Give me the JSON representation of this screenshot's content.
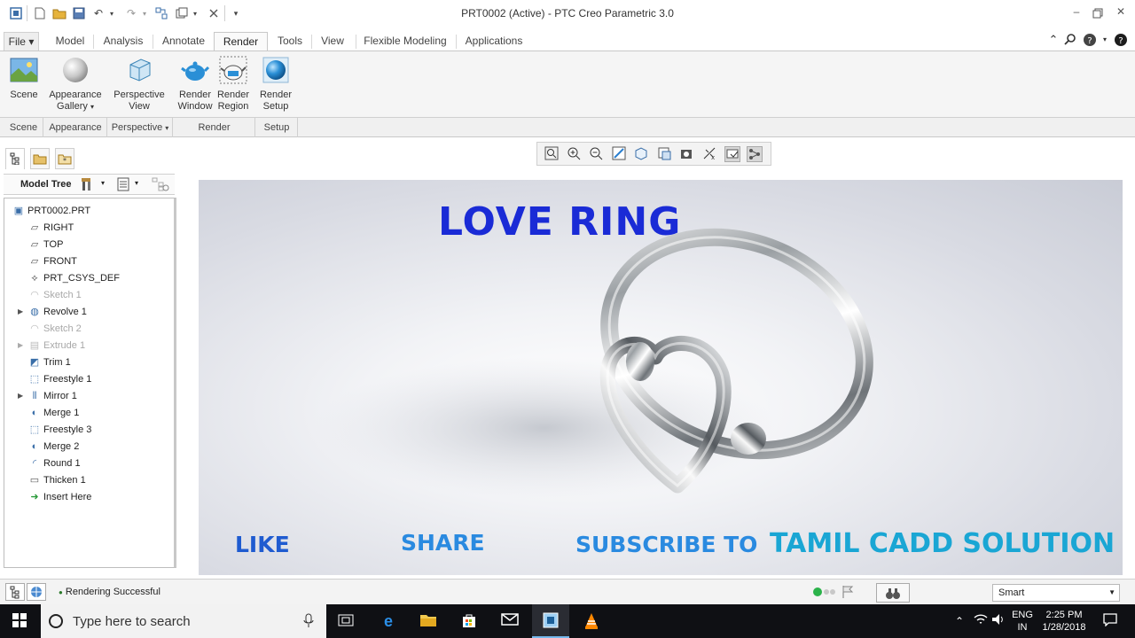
{
  "window": {
    "title": "PRT0002 (Active) - PTC Creo Parametric 3.0"
  },
  "tabs": [
    "Model",
    "Analysis",
    "Annotate",
    "Render",
    "Tools",
    "View",
    "Flexible Modeling",
    "Applications"
  ],
  "file_menu": "File",
  "active_tab": "Render",
  "ribbon": {
    "scene": "Scene",
    "appearance_line1": "Appearance",
    "appearance_line2": "Gallery",
    "perspective_line1": "Perspective",
    "perspective_line2": "View",
    "render_window_line1": "Render",
    "render_window_line2": "Window",
    "render_region_line1": "Render",
    "render_region_line2": "Region",
    "render_setup_line1": "Render",
    "render_setup_line2": "Setup",
    "groups": {
      "scene": "Scene",
      "appearance": "Appearance",
      "perspective": "Perspective",
      "render": "Render",
      "setup": "Setup"
    }
  },
  "model_tree": {
    "header": "Model Tree",
    "items": [
      {
        "label": "PRT0002.PRT",
        "icon": "part-icon"
      },
      {
        "label": "RIGHT",
        "icon": "datum-plane-icon"
      },
      {
        "label": "TOP",
        "icon": "datum-plane-icon"
      },
      {
        "label": "FRONT",
        "icon": "datum-plane-icon"
      },
      {
        "label": "PRT_CSYS_DEF",
        "icon": "csys-icon"
      },
      {
        "label": "Sketch 1",
        "icon": "sketch-icon"
      },
      {
        "label": "Revolve 1",
        "icon": "revolve-icon"
      },
      {
        "label": "Sketch 2",
        "icon": "sketch-icon"
      },
      {
        "label": "Extrude 1",
        "icon": "extrude-icon"
      },
      {
        "label": "Trim 1",
        "icon": "trim-icon"
      },
      {
        "label": "Freestyle 1",
        "icon": "freestyle-icon"
      },
      {
        "label": "Mirror 1",
        "icon": "mirror-icon"
      },
      {
        "label": "Merge 1",
        "icon": "merge-icon"
      },
      {
        "label": "Freestyle 3",
        "icon": "freestyle-icon"
      },
      {
        "label": "Merge 2",
        "icon": "merge-icon"
      },
      {
        "label": "Round 1",
        "icon": "round-icon"
      },
      {
        "label": "Thicken 1",
        "icon": "thicken-icon"
      },
      {
        "label": "Insert Here",
        "icon": "insert-arrow-icon"
      }
    ]
  },
  "viewport": {
    "title": "LOVE RING",
    "like": "LIKE",
    "share": "SHARE",
    "subscribe": "SUBSCRIBE TO",
    "channel": "TAMIL CADD SOLUTION"
  },
  "status": {
    "message": "Rendering Successful",
    "filter": "Smart"
  },
  "taskbar": {
    "search_placeholder": "Type here to search",
    "language_line1": "ENG",
    "language_line2": "IN",
    "time": "2:25 PM",
    "date": "1/28/2018"
  },
  "colors": {
    "title_blue": "#1a2bd6",
    "like_blue": "#1f5bd0",
    "share_blue": "#2a8ae0",
    "channel_cyan": "#1aa6d4",
    "taskbar": "#0f1014"
  }
}
